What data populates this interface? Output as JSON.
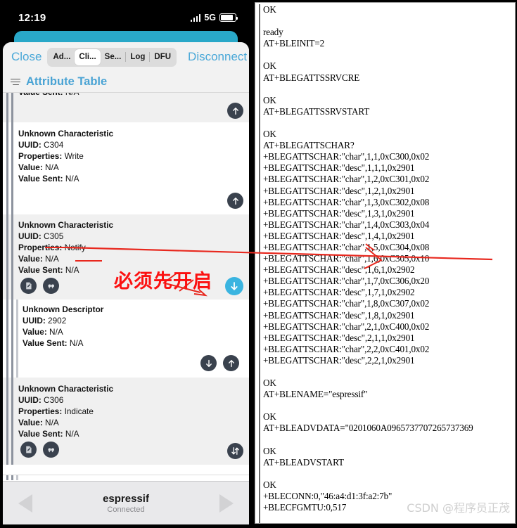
{
  "phone": {
    "status": {
      "time": "12:19",
      "network": "5G",
      "signal_icon": "signal-bars-icon",
      "battery_icon": "battery-icon"
    },
    "toolbar": {
      "close_label": "Close",
      "disconnect_label": "Disconnect",
      "segments": [
        {
          "label": "Ad...",
          "selected": false
        },
        {
          "label": "Cli...",
          "selected": true
        },
        {
          "label": "Se...",
          "selected": false
        },
        {
          "label": "Log",
          "selected": false
        },
        {
          "label": "DFU",
          "selected": false
        }
      ]
    },
    "section": {
      "icon": "hamburger-icon",
      "title": "Attribute Table"
    },
    "rows": [
      {
        "kind": "partial",
        "lines": [
          {
            "label": "Value Sent:",
            "value": "N/A"
          }
        ],
        "shade": "grey"
      },
      {
        "kind": "spacer",
        "shade": "grey",
        "right_buttons": [
          "arrow-up-icon"
        ]
      },
      {
        "kind": "attribute",
        "shade": "white",
        "title": "Unknown Characteristic",
        "lines": [
          {
            "label": "UUID:",
            "value": "C304"
          },
          {
            "label": "Properties:",
            "value": "Write"
          },
          {
            "label": "Value:",
            "value": "N/A"
          },
          {
            "label": "Value Sent:",
            "value": "N/A"
          }
        ]
      },
      {
        "kind": "spacer",
        "shade": "white",
        "right_buttons": [
          "arrow-up-icon"
        ]
      },
      {
        "kind": "attribute",
        "shade": "grey",
        "title": "Unknown Characteristic",
        "lines": [
          {
            "label": "UUID:",
            "value": "C305"
          },
          {
            "label": "Properties:",
            "value": "Notify"
          },
          {
            "label": "Value:",
            "value": "N/A"
          },
          {
            "label": "Value Sent:",
            "value": "N/A"
          }
        ],
        "buttons": [
          "write-document-icon",
          "quote-icon"
        ],
        "right_buttons": [
          "arrow-down-circle-icon-active"
        ]
      },
      {
        "kind": "attribute",
        "shade": "white",
        "title": "Unknown Descriptor",
        "lines": [
          {
            "label": "UUID:",
            "value": "2902"
          },
          {
            "label": "Value:",
            "value": "N/A"
          },
          {
            "label": "Value Sent:",
            "value": "N/A"
          }
        ]
      },
      {
        "kind": "spacer",
        "shade": "white",
        "right_buttons": [
          "arrow-down-icon",
          "arrow-up-icon"
        ]
      },
      {
        "kind": "attribute",
        "shade": "grey",
        "title": "Unknown Characteristic",
        "lines": [
          {
            "label": "UUID:",
            "value": "C306"
          },
          {
            "label": "Properties:",
            "value": "Indicate"
          },
          {
            "label": "Value:",
            "value": "N/A"
          },
          {
            "label": "Value Sent:",
            "value": "N/A"
          }
        ],
        "buttons": [
          "write-document-icon",
          "quote-icon"
        ],
        "right_buttons": [
          "arrow-up-down-icon"
        ]
      }
    ],
    "bottom": {
      "device_name": "espressif",
      "status": "Connected",
      "prev_icon": "nav-previous-icon",
      "next_icon": "nav-next-icon"
    }
  },
  "terminal": {
    "lines": [
      "OK",
      "",
      "ready",
      "AT+BLEINIT=2",
      "",
      "OK",
      "AT+BLEGATTSSRVCRE",
      "",
      "OK",
      "AT+BLEGATTSSRVSTART",
      "",
      "OK",
      "AT+BLEGATTSCHAR?",
      "+BLEGATTSCHAR:\"char\",1,1,0xC300,0x02",
      "+BLEGATTSCHAR:\"desc\",1,1,1,0x2901",
      "+BLEGATTSCHAR:\"char\",1,2,0xC301,0x02",
      "+BLEGATTSCHAR:\"desc\",1,2,1,0x2901",
      "+BLEGATTSCHAR:\"char\",1,3,0xC302,0x08",
      "+BLEGATTSCHAR:\"desc\",1,3,1,0x2901",
      "+BLEGATTSCHAR:\"char\",1,4,0xC303,0x04",
      "+BLEGATTSCHAR:\"desc\",1,4,1,0x2901",
      "+BLEGATTSCHAR:\"char\",1,5,0xC304,0x08",
      "+BLEGATTSCHAR:\"char\",1,6,0xC305,0x10",
      "+BLEGATTSCHAR:\"desc\",1,6,1,0x2902",
      "+BLEGATTSCHAR:\"char\",1,7,0xC306,0x20",
      "+BLEGATTSCHAR:\"desc\",1,7,1,0x2902",
      "+BLEGATTSCHAR:\"char\",1,8,0xC307,0x02",
      "+BLEGATTSCHAR:\"desc\",1,8,1,0x2901",
      "+BLEGATTSCHAR:\"char\",2,1,0xC400,0x02",
      "+BLEGATTSCHAR:\"desc\",2,1,1,0x2901",
      "+BLEGATTSCHAR:\"char\",2,2,0xC401,0x02",
      "+BLEGATTSCHAR:\"desc\",2,2,1,0x2901",
      "",
      "OK",
      "AT+BLENAME=\"espressif\"",
      "",
      "OK",
      "AT+BLEADVDATA=\"0201060A0965737707265737369",
      "",
      "OK",
      "AT+BLEADVSTART",
      "",
      "OK",
      "+BLECONN:0,\"46:a4:d1:3f:a2:7b\"",
      "+BLECFGMTU:0,517"
    ]
  },
  "annotations": {
    "note_text": "必须先开启",
    "note_color": "#fc1111",
    "watermark": "CSDN @程序员正茂"
  }
}
